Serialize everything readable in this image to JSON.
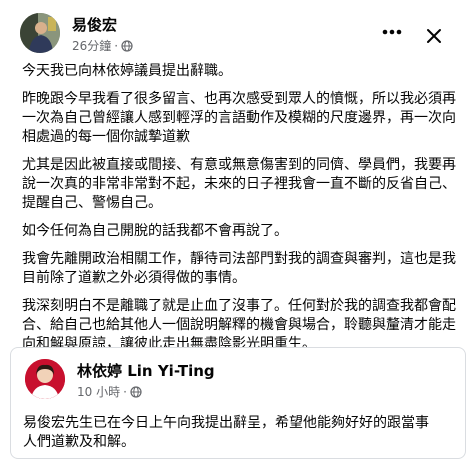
{
  "post": {
    "author": "易俊宏",
    "time": "26分鐘",
    "separator": "·",
    "paragraphs": [
      "今天我已向林依婷議員提出辭職。",
      "昨晚跟今早我看了很多留言、也再次感受到眾人的憤慨，所以我必須再\n一次為自己曾經讓人感到輕浮的言語動作及模糊的尺度邊界，再一次向\n相處過的每一個你誠摯道歉",
      "尤其是因此被直接或間接、有意或無意傷害到的同儕、學員們，我要再\n說一次真的非常非常對不起，未來的日子裡我會一直不斷的反省自己、\n提醒自己、警惕自己。",
      "如今任何為自己開脫的話我都不會再說了。",
      "我會先離開政治相關工作，靜待司法部門對我的調查與審判，這也是我\n目前除了道歉之外必須得做的事情。",
      "我深刻明白不是離職了就是止血了沒事了。任何對於我的調查我都會配\n合、給自己也給其他人一個說明解釋的機會與場合，聆聽與釐清才能走\n向和解與原諒，讓彼此走出無盡陰影光明重生。"
    ]
  },
  "shared": {
    "author": "林依婷 Lin Yi-Ting",
    "time": "10 小時",
    "separator": "·",
    "text": "易俊宏先生已在今日上午向我提出辭呈，希望他能夠好好的跟當事\n人們道歉及和解。"
  },
  "icons": {
    "more": "more-horizontal-icon",
    "close": "close-icon",
    "privacy": "globe-icon"
  },
  "colors": {
    "text": "#050505",
    "secondary": "#65676b",
    "border": "#dadde1",
    "shared_avatar_bg": "#c8102e"
  }
}
